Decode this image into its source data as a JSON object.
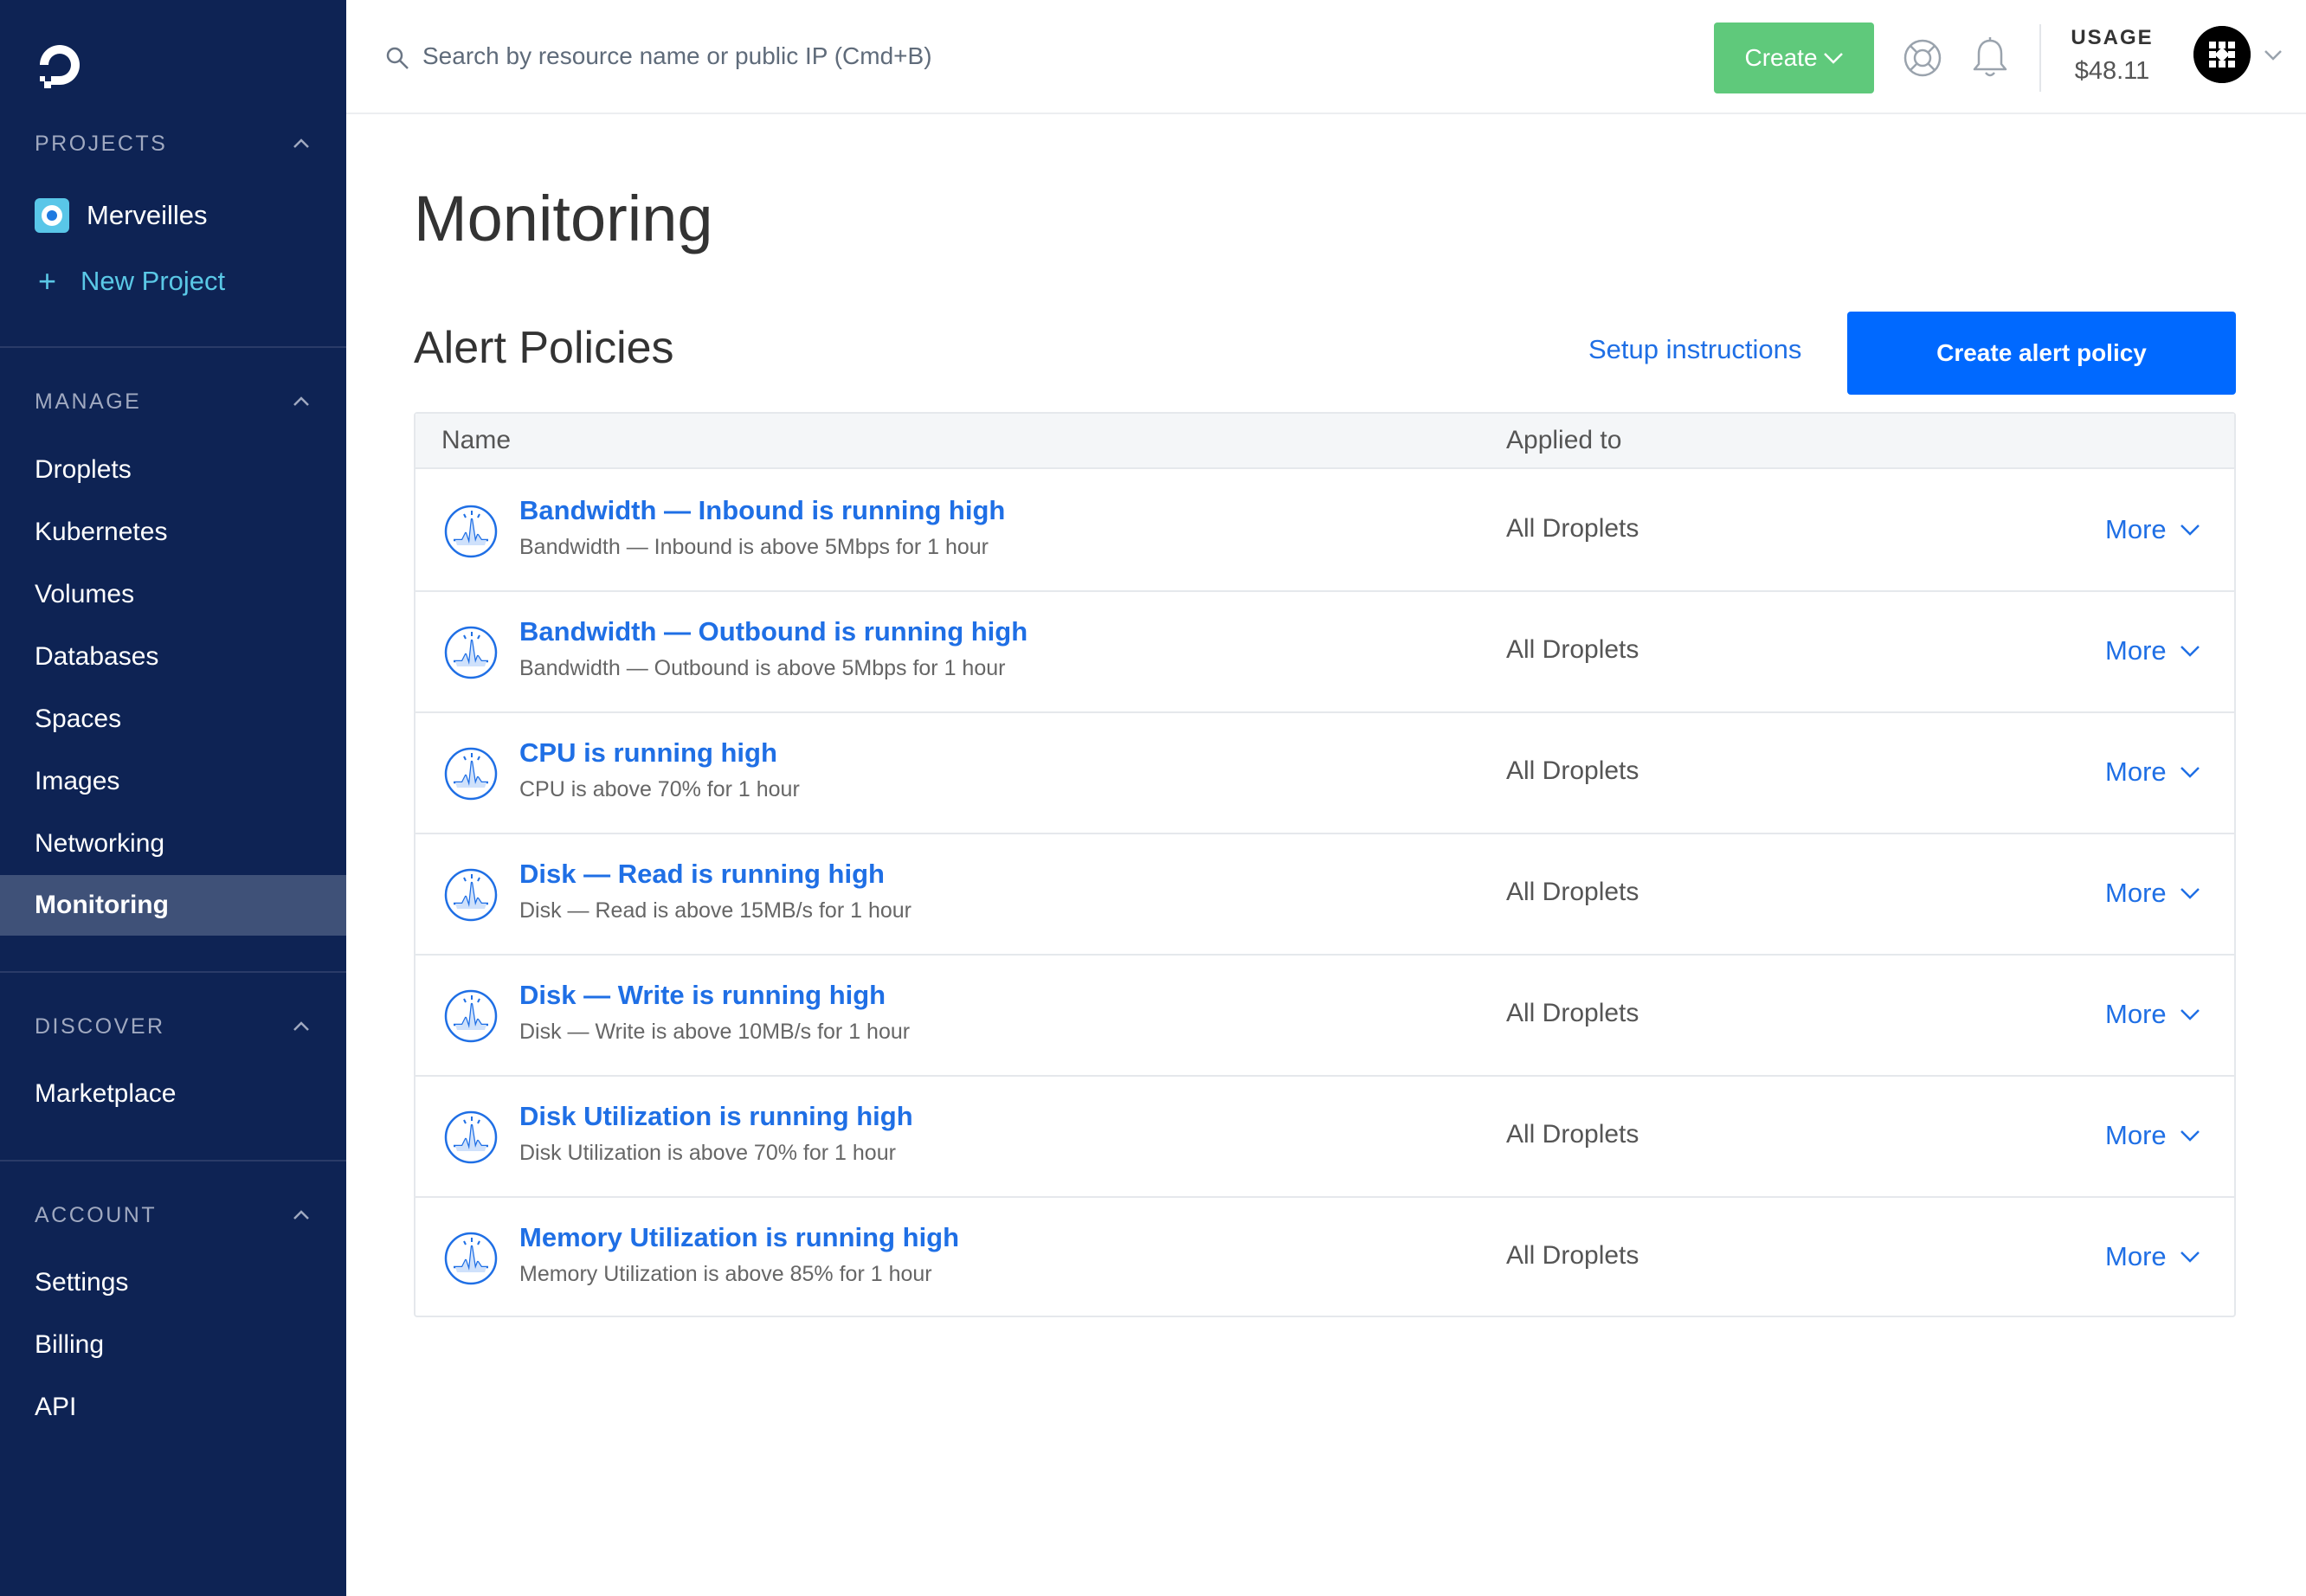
{
  "sidebar": {
    "projects_header": "PROJECTS",
    "project_name": "Merveilles",
    "new_project": "New Project",
    "manage_header": "MANAGE",
    "manage_items": [
      "Droplets",
      "Kubernetes",
      "Volumes",
      "Databases",
      "Spaces",
      "Images",
      "Networking",
      "Monitoring"
    ],
    "active_item": "Monitoring",
    "discover_header": "DISCOVER",
    "discover_items": [
      "Marketplace"
    ],
    "account_header": "ACCOUNT",
    "account_items": [
      "Settings",
      "Billing",
      "API"
    ]
  },
  "topbar": {
    "search_placeholder": "Search by resource name or public IP (Cmd+B)",
    "create_label": "Create",
    "usage_label": "USAGE",
    "usage_value": "$48.11"
  },
  "main": {
    "page_title": "Monitoring",
    "section_title": "Alert Policies",
    "setup_link": "Setup instructions",
    "create_button": "Create alert policy",
    "columns": {
      "name": "Name",
      "applied_to": "Applied to"
    },
    "policies": [
      {
        "title": "Bandwidth — Inbound is running high",
        "desc": "Bandwidth — Inbound is above 5Mbps for 1 hour",
        "applied": "All Droplets",
        "more": "More"
      },
      {
        "title": "Bandwidth — Outbound is running high",
        "desc": "Bandwidth — Outbound is above 5Mbps for 1 hour",
        "applied": "All Droplets",
        "more": "More"
      },
      {
        "title": "CPU is running high",
        "desc": "CPU is above 70% for 1 hour",
        "applied": "All Droplets",
        "more": "More"
      },
      {
        "title": "Disk — Read is running high",
        "desc": "Disk — Read is above 15MB/s for 1 hour",
        "applied": "All Droplets",
        "more": "More"
      },
      {
        "title": "Disk — Write is running high",
        "desc": "Disk — Write is above 10MB/s for 1 hour",
        "applied": "All Droplets",
        "more": "More"
      },
      {
        "title": "Disk Utilization is running high",
        "desc": "Disk Utilization is above 70% for 1 hour",
        "applied": "All Droplets",
        "more": "More"
      },
      {
        "title": "Memory Utilization is running high",
        "desc": "Memory Utilization is above 85% for 1 hour",
        "applied": "All Droplets",
        "more": "More"
      }
    ]
  },
  "icons": {
    "logo": "digitalocean-logo",
    "search": "search-icon",
    "help": "lifebuoy-icon",
    "notifications": "bell-icon",
    "policy": "pulse-monitor-icon",
    "chevron": "chevron-down-icon"
  },
  "colors": {
    "sidebar_bg": "#0e2354",
    "sidebar_active": "#3f5178",
    "link_blue": "#1f6fe5",
    "primary_button": "#0069ff",
    "create_button": "#5fc97b",
    "new_project": "#5ac8e6"
  }
}
